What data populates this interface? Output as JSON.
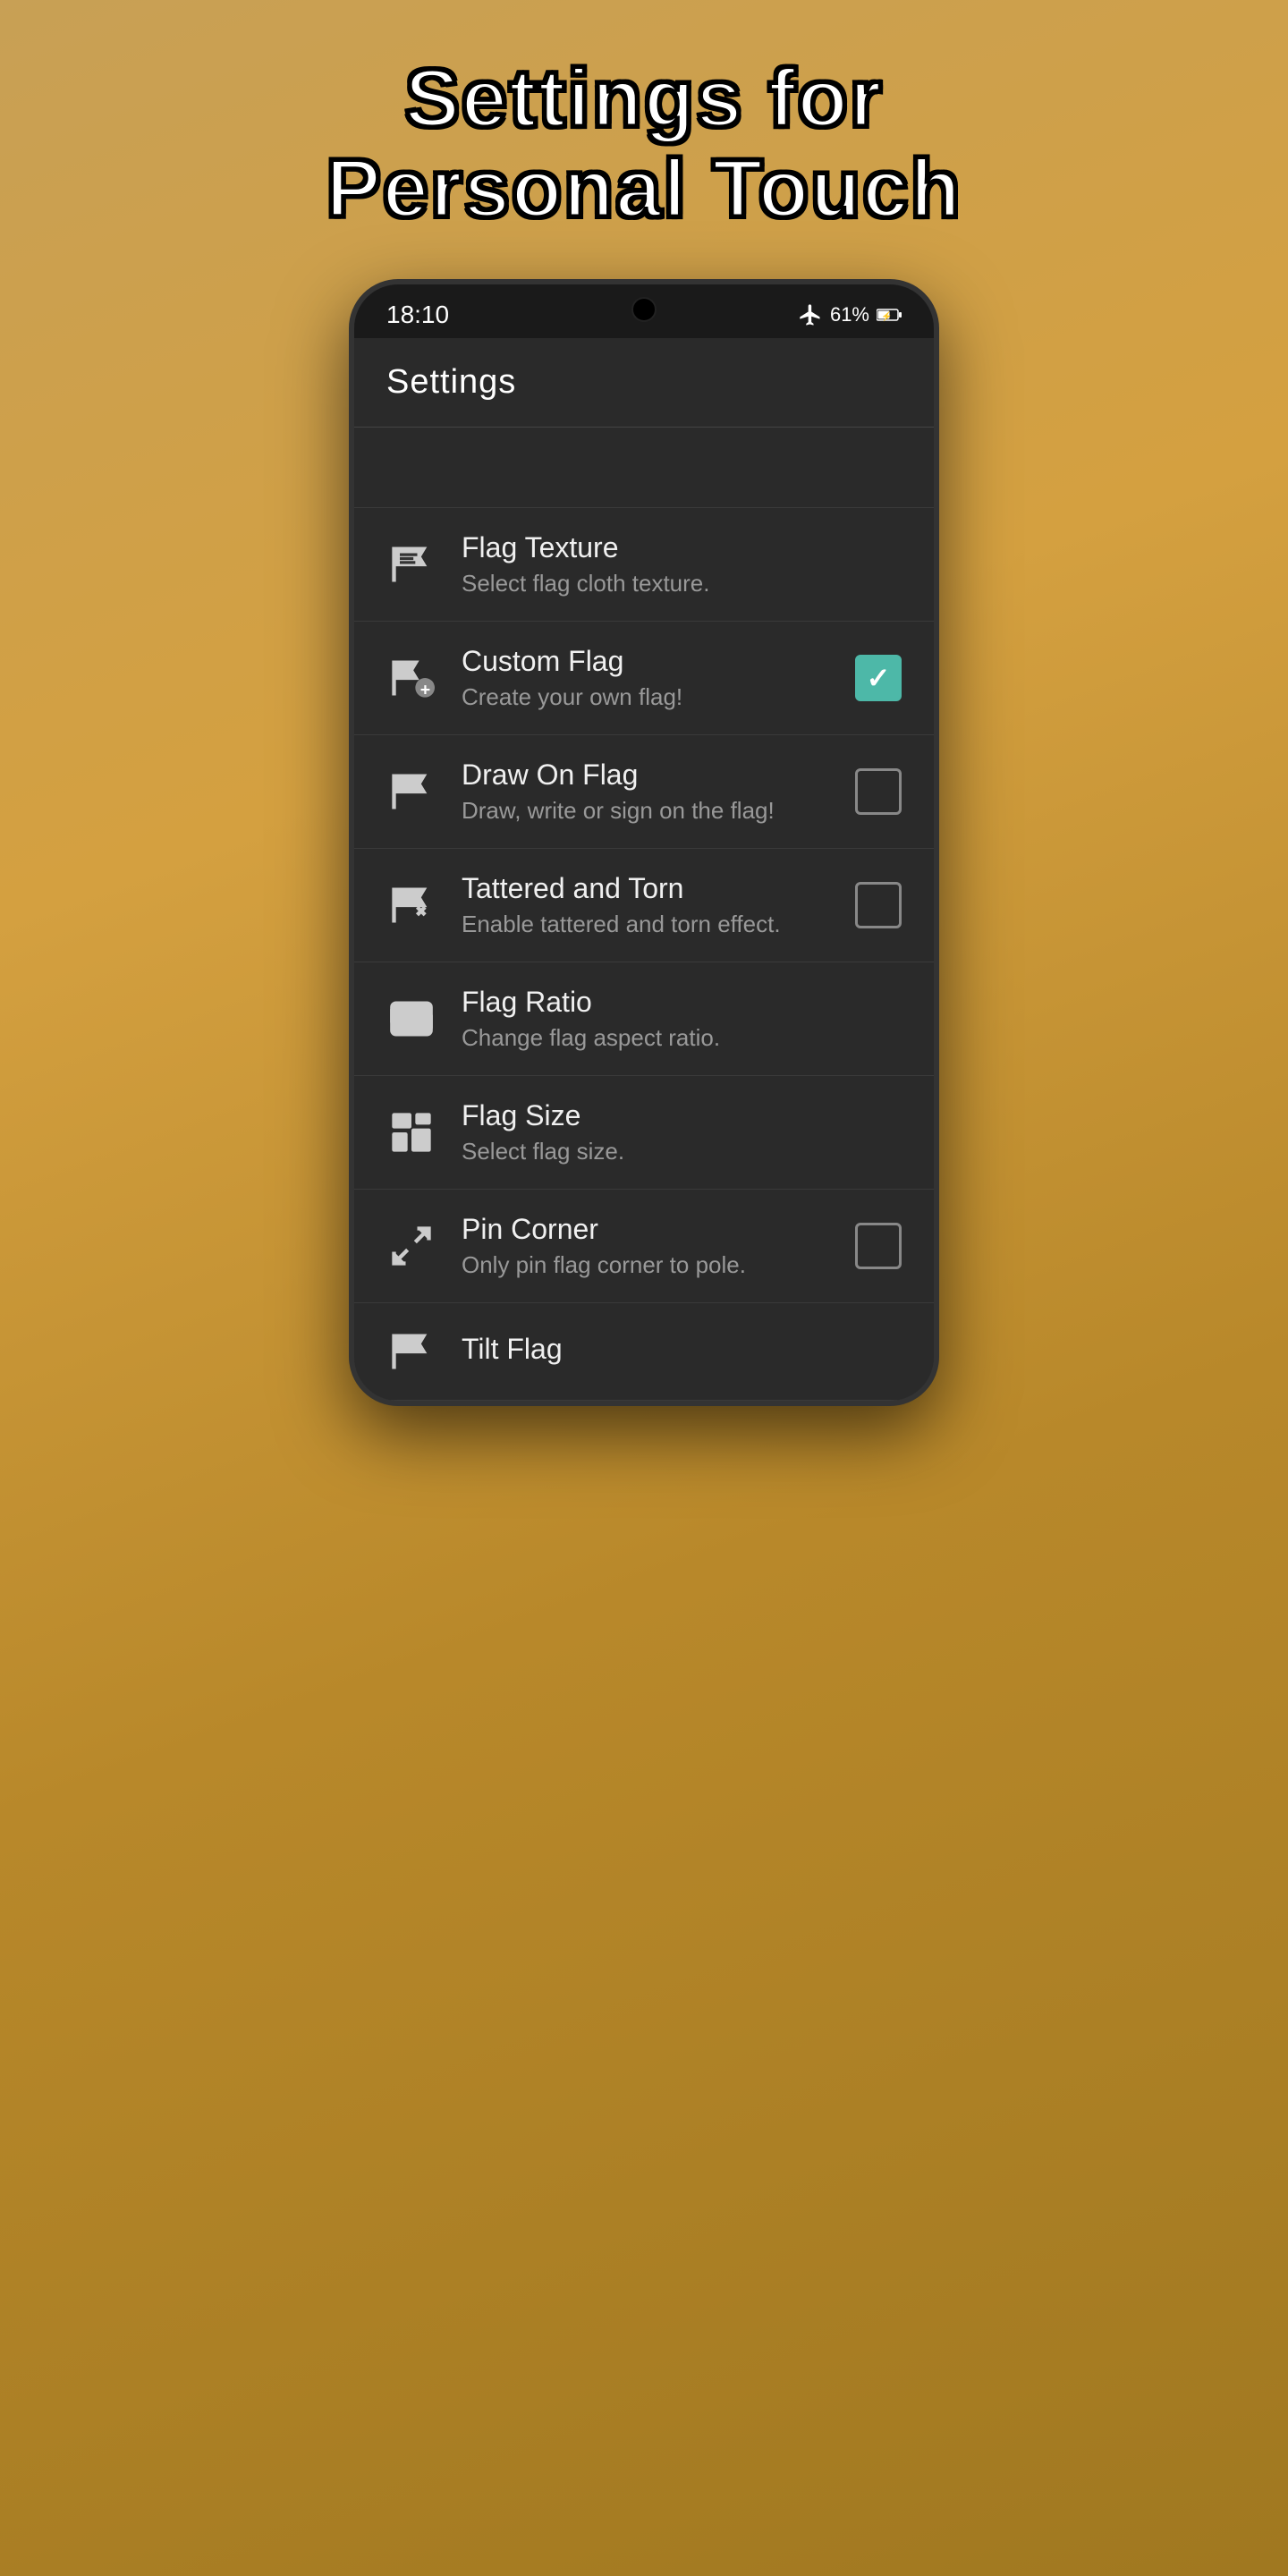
{
  "page": {
    "title_line1": "Settings for",
    "title_line2": "Personal Touch"
  },
  "status_bar": {
    "time": "18:10",
    "battery": "61%",
    "airplane_mode": true
  },
  "app_bar": {
    "title": "Settings"
  },
  "settings": {
    "items": [
      {
        "id": "flag-texture",
        "title": "Flag Texture",
        "subtitle": "Select flag cloth texture.",
        "has_checkbox": false,
        "checked": false,
        "icon": "flag-texture"
      },
      {
        "id": "custom-flag",
        "title": "Custom Flag",
        "subtitle": "Create your own flag!",
        "has_checkbox": true,
        "checked": true,
        "icon": "flag-plus"
      },
      {
        "id": "draw-on-flag",
        "title": "Draw On Flag",
        "subtitle": "Draw, write or sign on the flag!",
        "has_checkbox": true,
        "checked": false,
        "icon": "flag-wave"
      },
      {
        "id": "tattered-torn",
        "title": "Tattered and Torn",
        "subtitle": "Enable tattered and torn effect.",
        "has_checkbox": true,
        "checked": false,
        "icon": "flag-x"
      },
      {
        "id": "flag-ratio",
        "title": "Flag Ratio",
        "subtitle": "Change flag aspect ratio.",
        "has_checkbox": false,
        "checked": false,
        "icon": "aspect-ratio"
      },
      {
        "id": "flag-size",
        "title": "Flag Size",
        "subtitle": "Select flag size.",
        "has_checkbox": false,
        "checked": false,
        "icon": "flag-size"
      },
      {
        "id": "pin-corner",
        "title": "Pin Corner",
        "subtitle": "Only pin flag corner to pole.",
        "has_checkbox": true,
        "checked": false,
        "icon": "expand"
      },
      {
        "id": "tilt-flag",
        "title": "Tilt Flag",
        "subtitle": "",
        "has_checkbox": false,
        "checked": false,
        "icon": "flag-wave"
      }
    ]
  }
}
